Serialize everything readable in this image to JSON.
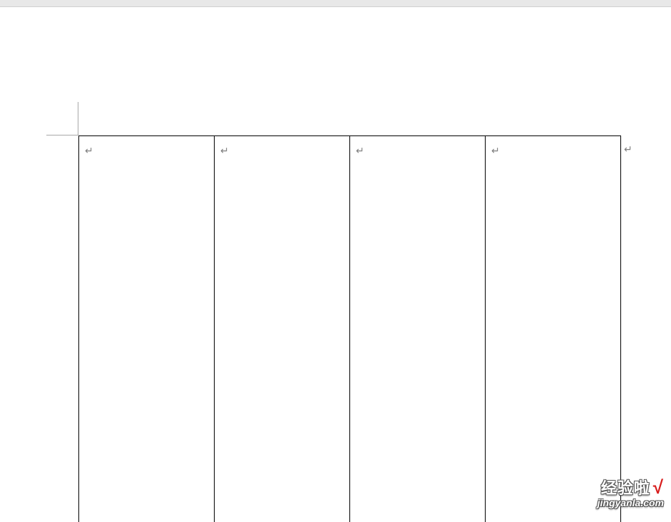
{
  "paragraph_mark": "↵",
  "table": {
    "rows": 1,
    "cols": 4,
    "cells": [
      {
        "content": "↵"
      },
      {
        "content": "↵"
      },
      {
        "content": "↵"
      },
      {
        "content": "↵"
      }
    ]
  },
  "trailing_paragraph_mark": "↵",
  "watermark": {
    "line1": "经验啦",
    "check": "√",
    "line2": "jingyanla.com"
  }
}
